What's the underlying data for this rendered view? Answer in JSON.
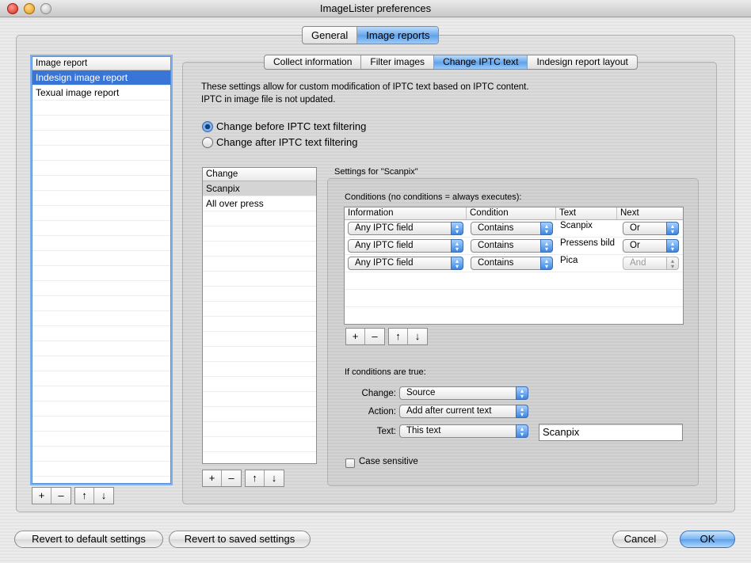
{
  "window": {
    "title": "ImageLister preferences"
  },
  "main_tabs": [
    "General",
    "Image reports"
  ],
  "sub_tabs": [
    "Collect information",
    "Filter images",
    "Change IPTC text",
    "Indesign report layout"
  ],
  "report_list": {
    "header": "Image report",
    "items": [
      "Indesign image report",
      "Texual image report"
    ]
  },
  "description": {
    "line1": "These settings allow for custom modification of IPTC text based on IPTC content.",
    "line2": "IPTC in image file is not updated."
  },
  "timing": {
    "before": "Change before IPTC text filtering",
    "after": "Change after IPTC text filtering",
    "selected": "before"
  },
  "change_list": {
    "header": "Change",
    "items": [
      "Scanpix",
      "All over press"
    ]
  },
  "settings_title": "Settings for \"Scanpix\"",
  "conditions": {
    "label": "Conditions (no conditions = always executes):",
    "columns": [
      "Information",
      "Condition",
      "Text",
      "Next"
    ],
    "rows": [
      {
        "information": "Any IPTC field",
        "condition": "Contains",
        "text": "Scanpix",
        "next": "Or"
      },
      {
        "information": "Any IPTC field",
        "condition": "Contains",
        "text": "Pressens bild",
        "next": "Or"
      },
      {
        "information": "Any IPTC field",
        "condition": "Contains",
        "text": "Pica",
        "next": "And"
      }
    ]
  },
  "action_section": {
    "label": "If conditions are true:",
    "change_label": "Change:",
    "change_value": "Source",
    "action_label": "Action:",
    "action_value": "Add after current text",
    "text_label": "Text:",
    "text_value": "This text",
    "text_input": "Scanpix"
  },
  "case_sensitive": {
    "label": "Case sensitive",
    "checked": false
  },
  "list_buttons": [
    "+",
    "–",
    "↑",
    "↓"
  ],
  "footer": {
    "revert_default": "Revert to default settings",
    "revert_saved": "Revert to saved settings",
    "cancel": "Cancel",
    "ok": "OK"
  }
}
